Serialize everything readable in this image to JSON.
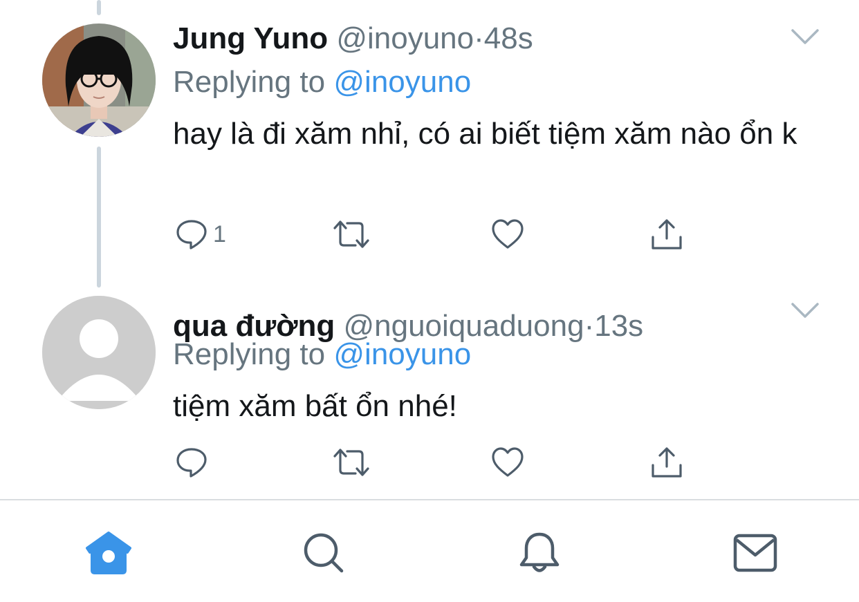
{
  "tweets": [
    {
      "name": "Jung Yuno",
      "handle": "@inoyuno",
      "separator": "·",
      "time": "48s",
      "replying_prefix": "Replying to",
      "replying_to": "@inoyuno",
      "text": "hay là đi xăm nhỉ, có ai biết tiệm xăm nào ổn k",
      "reply_count": "1",
      "avatar_icon": "profile-photo"
    },
    {
      "name": "qua đường",
      "handle": "@nguoiquaduong",
      "separator": "·",
      "time": "13s",
      "replying_prefix": "Replying to",
      "replying_to": "@inoyuno",
      "text": "tiệm xăm bất ổn nhé!",
      "reply_count": "",
      "avatar_icon": "default-profile-icon"
    }
  ],
  "tab_bar": {
    "items": [
      "home-icon",
      "search-icon",
      "bell-icon",
      "mail-icon"
    ],
    "active": "home-icon"
  },
  "colors": {
    "accent": "#3a94e8",
    "secondary_text": "#66757f",
    "thread_line": "#cbd5dd",
    "icon_gray": "#4d5c6a"
  }
}
